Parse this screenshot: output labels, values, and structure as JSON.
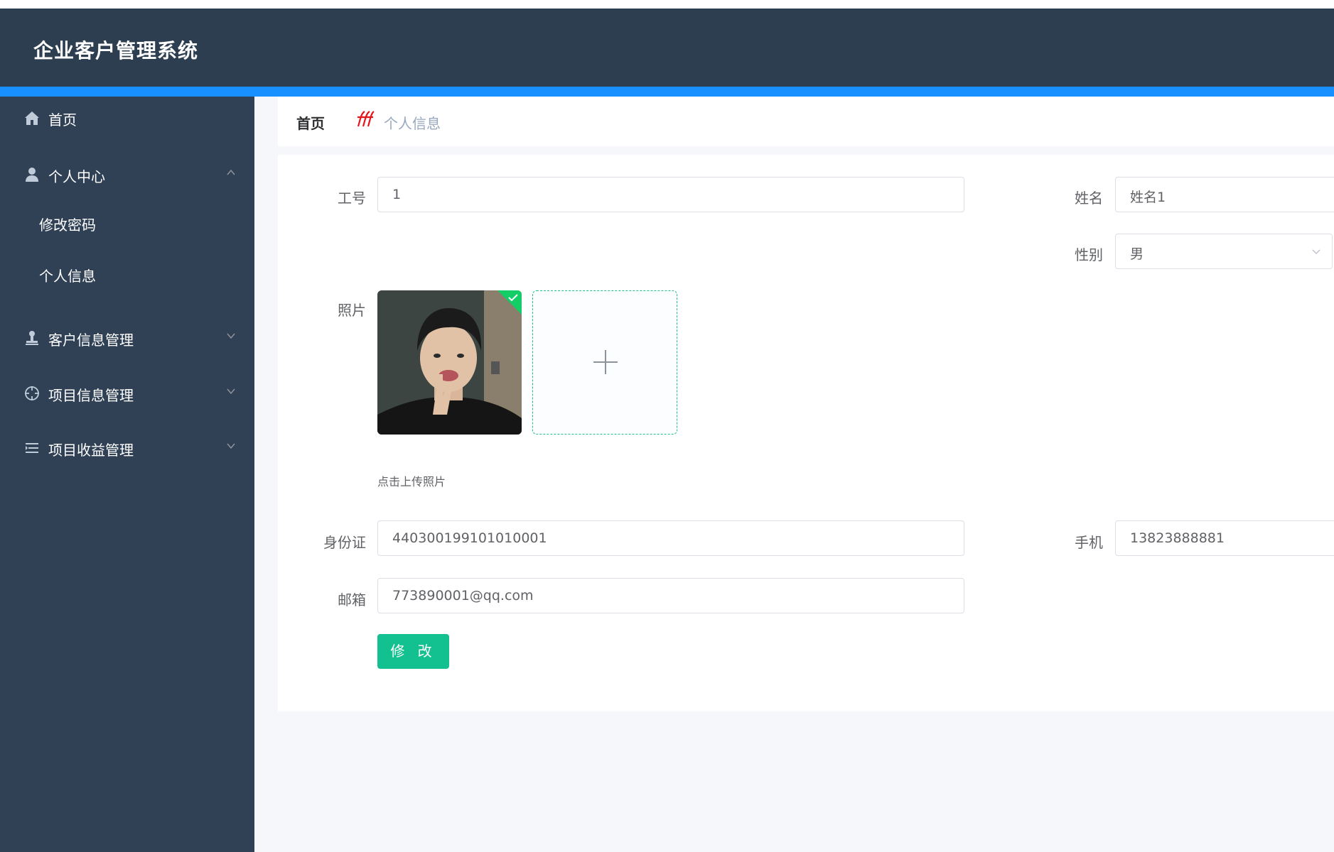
{
  "app": {
    "title": "企业客户管理系统"
  },
  "sidebar": {
    "items": [
      {
        "label": "首页",
        "icon": "home-icon"
      },
      {
        "label": "个人中心",
        "icon": "user-icon",
        "expanded": true,
        "children": [
          {
            "label": "修改密码"
          },
          {
            "label": "个人信息"
          }
        ]
      },
      {
        "label": "客户信息管理",
        "icon": "stamp-icon",
        "expanded": false
      },
      {
        "label": "项目信息管理",
        "icon": "crosshair-icon",
        "expanded": false
      },
      {
        "label": "项目收益管理",
        "icon": "list-icon",
        "expanded": false
      }
    ]
  },
  "breadcrumb": {
    "home": "首页",
    "separator_icon": "fff-separator-icon",
    "current": "个人信息"
  },
  "form": {
    "job_no": {
      "label": "工号",
      "value": "1"
    },
    "name": {
      "label": "姓名",
      "value": "姓名1"
    },
    "gender": {
      "label": "性别",
      "value": "男"
    },
    "photo": {
      "label": "照片",
      "tip": "点击上传照片"
    },
    "id_card": {
      "label": "身份证",
      "value": "440300199101010001"
    },
    "phone": {
      "label": "手机",
      "value": "13823888881"
    },
    "email": {
      "label": "邮箱",
      "value": "773890001@qq.com"
    },
    "submit_label": "修 改"
  },
  "colors": {
    "header": "#2c3e50",
    "accent_bar": "#1890ff",
    "sidebar": "#304156",
    "primary_button": "#13c08f",
    "upload_success": "#13ce66"
  }
}
